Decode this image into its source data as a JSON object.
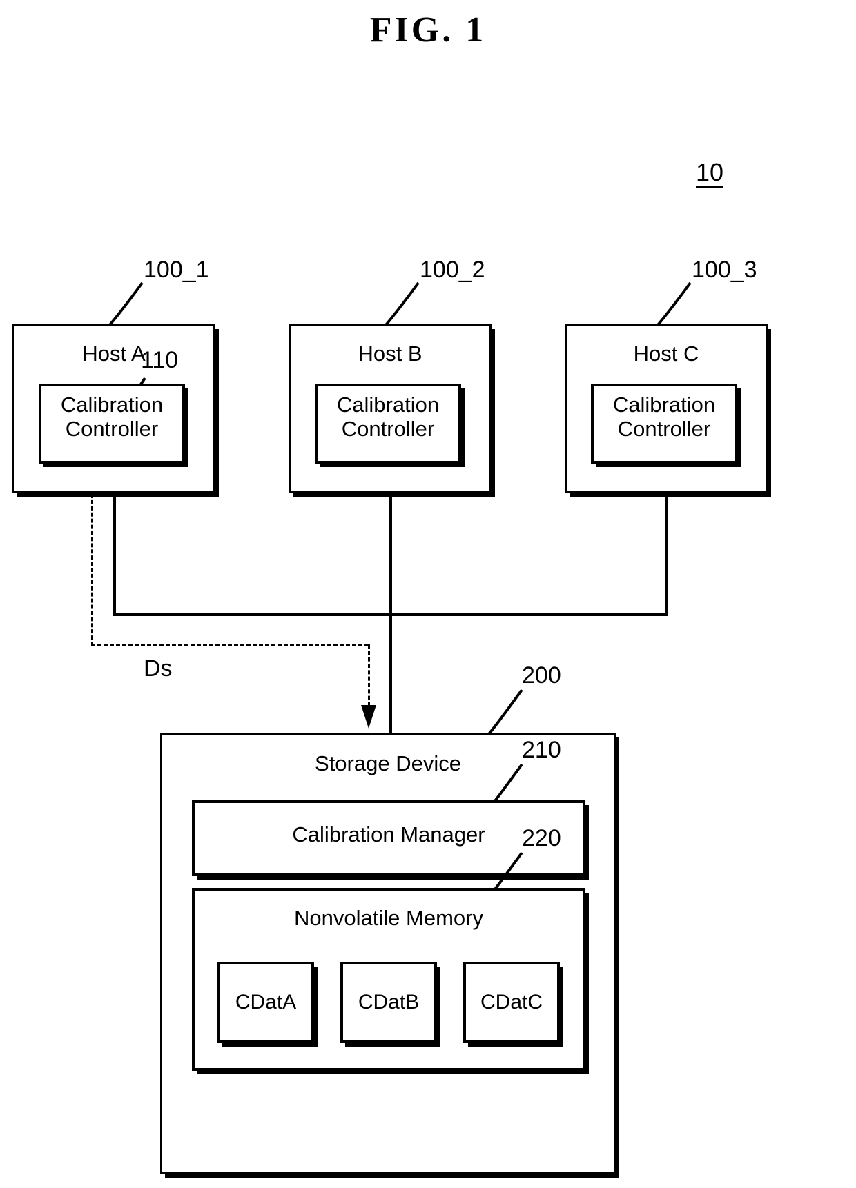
{
  "figure": {
    "title": "FIG.  1",
    "system_ref": "10"
  },
  "hosts": [
    {
      "name": "Host A",
      "ref": "100_1",
      "controller": {
        "line1": "Calibration",
        "line2": "Controller",
        "ref": "110"
      }
    },
    {
      "name": "Host B",
      "ref": "100_2",
      "controller": {
        "line1": "Calibration",
        "line2": "Controller",
        "ref": ""
      }
    },
    {
      "name": "Host C",
      "ref": "100_3",
      "controller": {
        "line1": "Calibration",
        "line2": "Controller",
        "ref": ""
      }
    }
  ],
  "signals": {
    "ds_label": "Ds"
  },
  "storage": {
    "title": "Storage Device",
    "ref": "200",
    "calibration_manager": {
      "title": "Calibration Manager",
      "ref": "210"
    },
    "nonvolatile_memory": {
      "title": "Nonvolatile Memory",
      "ref": "220",
      "blocks": [
        {
          "label": "CDatA"
        },
        {
          "label": "CDatB"
        },
        {
          "label": "CDatC"
        }
      ]
    }
  },
  "colors": {
    "ink": "#000000",
    "paper": "#ffffff"
  }
}
